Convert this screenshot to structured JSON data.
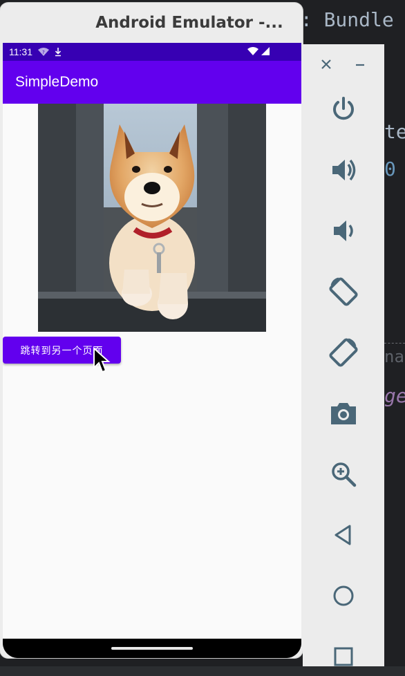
{
  "emulator": {
    "title": "Android Emulator -..."
  },
  "status_bar": {
    "time": "11:31"
  },
  "app": {
    "title": "SimpleDemo",
    "image_subject": "shiba-inu-dog-photo",
    "button_label": "跳转到另一个页面"
  },
  "ide": {
    "code_top": "e: Bundle",
    "frag_1": "te",
    "frag_2": "0",
    "frag_3": "na",
    "frag_4": "ge"
  },
  "toolbar": {
    "close_icon": "close-icon",
    "minimize_icon": "minimize-icon",
    "buttons": [
      "power-icon",
      "volume-up-icon",
      "volume-down-icon",
      "rotate-left-icon",
      "rotate-right-icon",
      "camera-icon",
      "zoom-icon",
      "back-icon",
      "home-icon",
      "overview-icon"
    ]
  },
  "colors": {
    "status_bar": "#3700b3",
    "primary": "#6200ee",
    "icon": "#4a6778",
    "ide_bg": "#1f2023"
  }
}
